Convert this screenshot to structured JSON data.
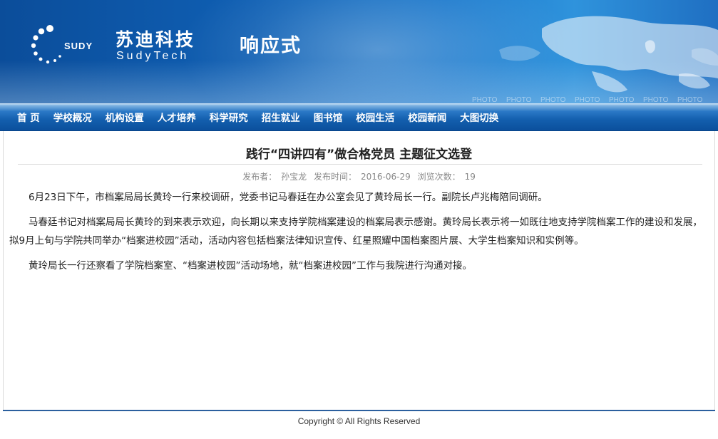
{
  "header": {
    "logo_en": "SUDY",
    "logo_cn": "苏迪科技",
    "logo_tech": "SudyTech",
    "site_title": "响应式",
    "photo_labels": [
      "PHOTO",
      "PHOTO",
      "PHOTO",
      "PHOTO",
      "PHOTO",
      "PHOTO",
      "PHOTO"
    ]
  },
  "nav": {
    "items": [
      "首 页",
      "学校概况",
      "机构设置",
      "人才培养",
      "科学研究",
      "招生就业",
      "图书馆",
      "校园生活",
      "校园新闻",
      "大图切换"
    ]
  },
  "article": {
    "title": "践行“四讲四有”做合格党员 主题征文选登",
    "meta": {
      "author_label": "发布者：",
      "author": "孙宝龙",
      "time_label": "发布时间：",
      "time": "2016-06-29",
      "views_label": "浏览次数：",
      "views": "19"
    },
    "paragraphs": [
      "6月23日下午，市档案局局长黄玲一行来校调研，党委书记马春廷在办公室会见了黄玲局长一行。副院长卢兆梅陪同调研。",
      "马春廷书记对档案局局长黄玲的到来表示欢迎，向长期以来支持学院档案建设的档案局表示感谢。黄玲局长表示将一如既往地支持学院档案工作的建设和发展，拟9月上旬与学院共同举办“档案进校园”活动，活动内容包括档案法律知识宣传、红星照耀中国档案图片展、大学生档案知识和实例等。",
      "黄玲局长一行还察看了学院档案室、“档案进校园”活动场地，就“档案进校园”工作与我院进行沟通对接。"
    ]
  },
  "footer": {
    "copyright": "Copyright © All Rights Reserved"
  },
  "colors": {
    "header_blue": "#0f5fb3",
    "nav_blue": "#135fae",
    "footer_line": "#2b5f9e"
  }
}
